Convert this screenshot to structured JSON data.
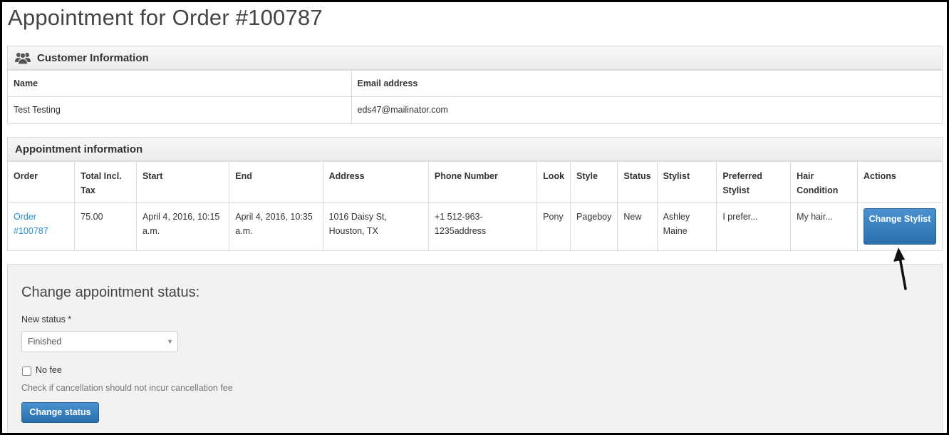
{
  "page": {
    "title": "Appointment for Order #100787"
  },
  "customer": {
    "heading": "Customer Information",
    "icon": "users-icon",
    "columns": [
      "Name",
      "Email address"
    ],
    "row": {
      "name": "Test Testing",
      "email": "eds47@mailinator.com"
    }
  },
  "appointment": {
    "heading": "Appointment information",
    "columns": [
      "Order",
      "Total Incl. Tax",
      "Start",
      "End",
      "Address",
      "Phone Number",
      "Look",
      "Style",
      "Status",
      "Stylist",
      "Preferred Stylist",
      "Hair Condition",
      "Actions"
    ],
    "row": {
      "order": "Order #100787",
      "total": "75.00",
      "start": "April 4, 2016, 10:15 a.m.",
      "end": "April 4, 2016, 10:35 a.m.",
      "address": "1016 Daisy St, Houston, TX",
      "phone": "+1 512-963-1235address",
      "look": "Pony",
      "style": "Pageboy",
      "status": "New",
      "stylist": "Ashley Maine",
      "preferred_stylist": "I prefer...",
      "hair_condition": "My hair...",
      "action_label": "Change Stylist"
    },
    "link_color": "#2a8fd0"
  },
  "status_form": {
    "title": "Change appointment status:",
    "field_label": "New status *",
    "selected_status": "Finished",
    "checkbox_label": "No fee",
    "checkbox_checked": false,
    "help_text": "Check if cancellation should not incur cancellation fee",
    "submit_label": "Change status"
  },
  "colors": {
    "button": "#337ab7",
    "panel_bg": "#f2f2f2"
  }
}
